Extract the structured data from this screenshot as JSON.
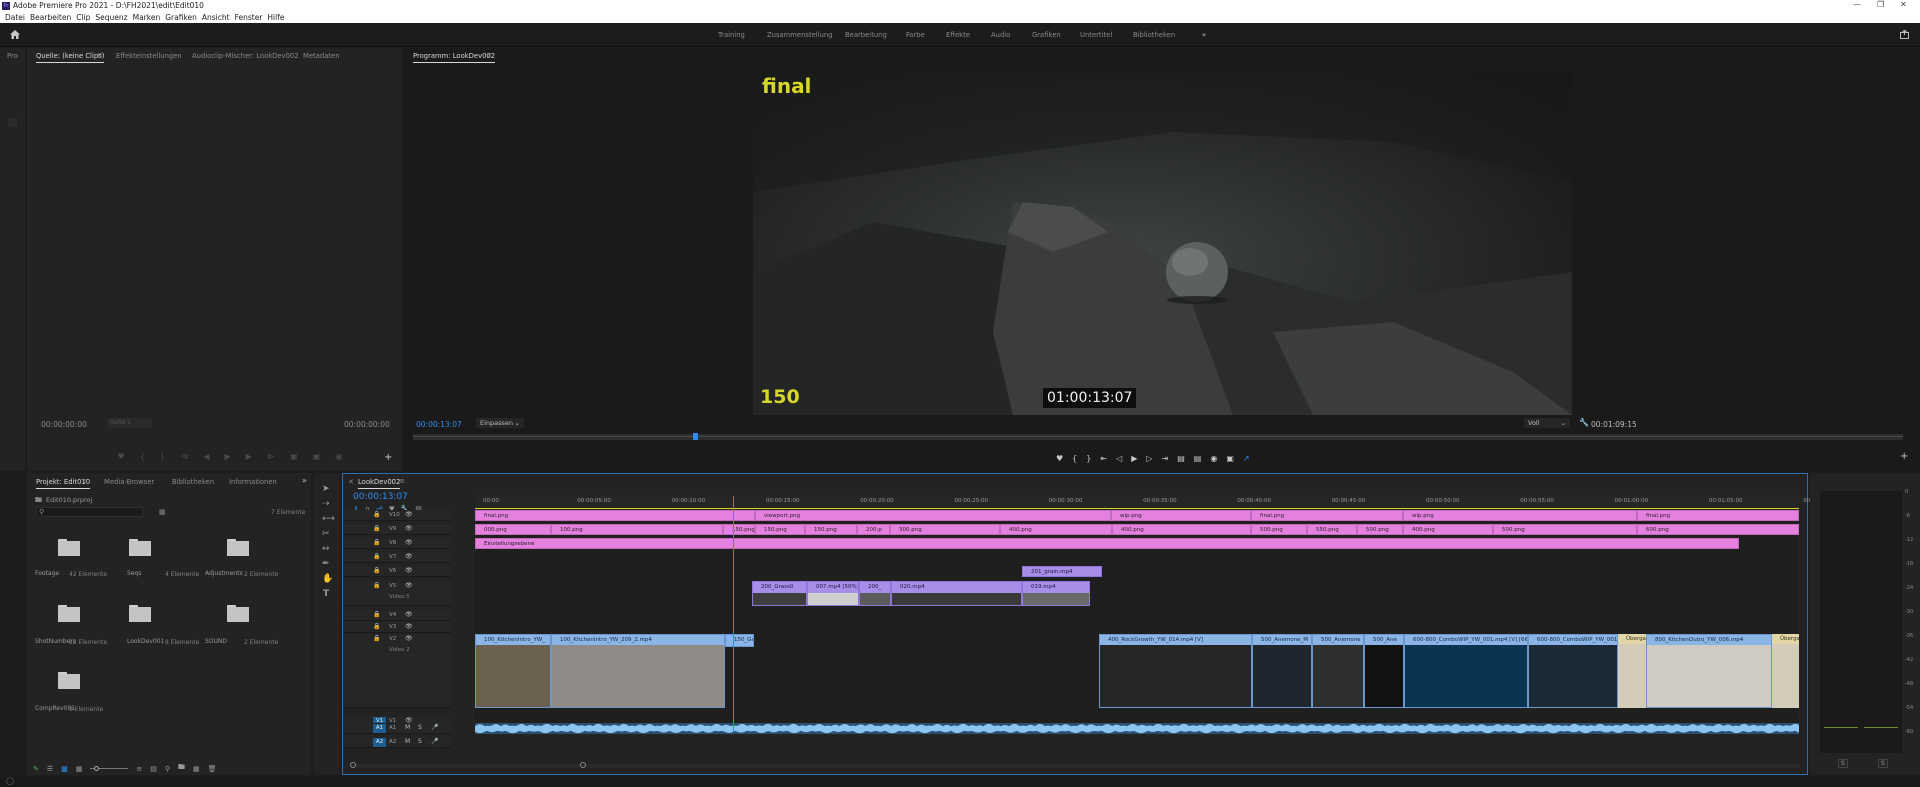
{
  "app": {
    "title": "Adobe Premiere Pro 2021 - D:\\FH2021\\edit\\Edit010",
    "logo": "Pr"
  },
  "menu": [
    "Datei",
    "Bearbeiten",
    "Clip",
    "Sequenz",
    "Marken",
    "Grafiken",
    "Ansicht",
    "Fenster",
    "Hilfe"
  ],
  "workspaces": [
    "Training",
    "Zusammenstellung",
    "Bearbeitung",
    "Farbe",
    "Effekte",
    "Audio",
    "Grafiken",
    "Untertitel",
    "Bibliotheken"
  ],
  "source_panel": {
    "stub_tab": "Pro",
    "tabs": [
      "Quelle: (keine Clips)",
      "Effekteinstellungen",
      "Audioclip-Mischer: LookDev002",
      "Metadaten"
    ],
    "timecode_left": "00:00:00:00",
    "fit_label": "Seite 1",
    "timecode_right": "00:00:00:00"
  },
  "program_monitor": {
    "tab": "Programm: LookDev002",
    "overlay_title": "final",
    "overlay_number": "150",
    "overlay_timecode": "01:00:13:07",
    "timecode": "00:00:13:07",
    "fit": "Einpassen",
    "quality": "Voll",
    "duration": "00:01:09:15",
    "playhead_fraction": 0.188
  },
  "project_panel": {
    "tabs": [
      "Projekt: Edit010",
      "Media-Browser",
      "Bibliotheken",
      "Informationen"
    ],
    "file": "Edit010.prproj",
    "count": "7 Elemente",
    "bins": [
      {
        "name": "Footage",
        "count": "42 Elemente"
      },
      {
        "name": "Seqs",
        "count": "4 Elemente"
      },
      {
        "name": "Adjustments",
        "count": "2 Elemente"
      },
      {
        "name": "ShotNumbers",
        "count": "22 Elemente"
      },
      {
        "name": "LookDev001",
        "count": "8 Elemente"
      },
      {
        "name": "SOUND",
        "count": "2 Elemente"
      },
      {
        "name": "CompRev001",
        "count": "9 Elemente"
      }
    ]
  },
  "timeline": {
    "tab": "LookDev002",
    "timecode": "00:00:13:07",
    "ruler": [
      "00:00",
      "00:00:05:00",
      "00:00:10:00",
      "00:00:15:00",
      "00:00:20:00",
      "00:00:25:00",
      "00:00:30:00",
      "00:00:35:00",
      "00:00:40:00",
      "00:00:45:00",
      "00:00:50:00",
      "00:00:55:00",
      "00:01:00:00",
      "00:01:05:00",
      "00:01:"
    ],
    "tracks": [
      "V10",
      "V9",
      "V8",
      "V7",
      "V6",
      "V5",
      "V4",
      "V3",
      "V2",
      "V1",
      "A1",
      "A2"
    ],
    "track_names": {
      "V5": "Video 5",
      "V2": "Video 2"
    },
    "clips_v10": [
      "final.png",
      "viewport.png",
      "wip.png",
      "final.png",
      "wip.png",
      "final.png"
    ],
    "clips_v9": [
      "000.png",
      "100.png",
      "150.png",
      "150.png",
      "150.png",
      "200.p",
      "300.png",
      "400.png",
      "400.png",
      "500.png",
      "550.png",
      "500.png",
      "400.png",
      "500.png",
      "600.png"
    ],
    "clips_v8": [
      "Einstellungsebene"
    ],
    "clips_v6": [
      "201_grain.mp4"
    ],
    "clips_v5": [
      "200_Grass0",
      "007.mp4 [50%]",
      "200_",
      "020.mp4",
      "019.mp4"
    ],
    "clips_v2": [
      "100_KitchenIntro_YW_",
      "100_KitchenIntro_YW_209_2.mp4",
      "150_Ga",
      "400_RockGrowth_YW_014.mp4 [V]",
      "500_Anemone_M",
      "500_Anemone",
      "500_Ane",
      "600-800_ComboWIP_YW_001.mp4 [V] [66%]",
      "600-800_ComboWIP_YW_001.m",
      "Übergang",
      "800_KitchenOutro_YW_006.mp4",
      "Übergang"
    ],
    "track_labels": {
      "v1": "V1",
      "a1": "A1",
      "a2": "A2",
      "m": "M",
      "s": "S"
    }
  },
  "meter": {
    "scale": [
      "0",
      "-6",
      "-12",
      "-18",
      "-24",
      "-30",
      "-36",
      "-42",
      "-48",
      "-54",
      "-60"
    ],
    "solo": [
      "S",
      "S"
    ]
  },
  "colors": {
    "pink": "#e480dd",
    "purple": "#a88ee9",
    "blue_clip": "#8bb5e7",
    "accent": "#2d8ceb",
    "overlay_yellow": "#d6d72a"
  }
}
